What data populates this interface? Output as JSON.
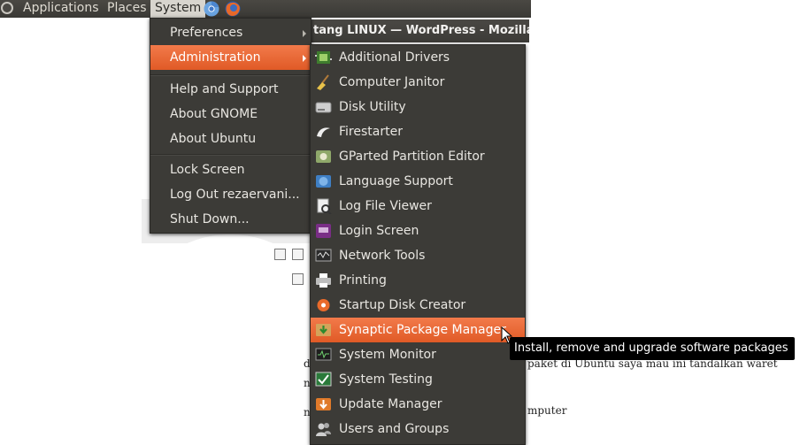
{
  "panel": {
    "applications": "Applications",
    "places": "Places",
    "system": "System"
  },
  "window_title": "tang LINUX — WordPress - Mozilla",
  "system_menu": {
    "items": [
      {
        "label": "Preferences",
        "submenu": true
      },
      {
        "label": "Administration",
        "submenu": true,
        "active": true
      },
      {
        "label": "Help and Support"
      },
      {
        "label": "About GNOME"
      },
      {
        "label": "About Ubuntu"
      },
      {
        "label": "Lock Screen"
      },
      {
        "label": "Log Out rezaervani..."
      },
      {
        "label": "Shut Down..."
      }
    ]
  },
  "admin_menu": {
    "items": [
      {
        "label": "Additional Drivers",
        "icon": "additional-drivers-icon"
      },
      {
        "label": "Computer Janitor",
        "icon": "broom-icon"
      },
      {
        "label": "Disk Utility",
        "icon": "disk-icon"
      },
      {
        "label": "Firestarter",
        "icon": "firestarter-icon"
      },
      {
        "label": "GParted Partition Editor",
        "icon": "gparted-icon"
      },
      {
        "label": "Language Support",
        "icon": "language-icon"
      },
      {
        "label": "Log File Viewer",
        "icon": "log-viewer-icon"
      },
      {
        "label": "Login Screen",
        "icon": "login-screen-icon"
      },
      {
        "label": "Network Tools",
        "icon": "network-tools-icon"
      },
      {
        "label": "Printing",
        "icon": "printer-icon"
      },
      {
        "label": "Startup Disk Creator",
        "icon": "startup-disk-icon"
      },
      {
        "label": "Synaptic Package Manager",
        "icon": "synaptic-icon",
        "active": true
      },
      {
        "label": "System Monitor",
        "icon": "system-monitor-icon"
      },
      {
        "label": "System Testing",
        "icon": "system-testing-icon"
      },
      {
        "label": "Update Manager",
        "icon": "update-manager-icon"
      },
      {
        "label": "Users and Groups",
        "icon": "users-icon"
      }
    ]
  },
  "tooltip": "Install, remove and upgrade software packages",
  "background_text": {
    "line1": "paket di Ubuntu saya mau ini tandalkan waret",
    "line2": "mputer",
    "left1": "d",
    "left2": "n",
    "left3": "n"
  },
  "colors": {
    "panel_bg": "#3c3b37",
    "menu_bg": "#3c3b37",
    "accent": "#e9632f",
    "tooltip_bg": "#000000"
  }
}
